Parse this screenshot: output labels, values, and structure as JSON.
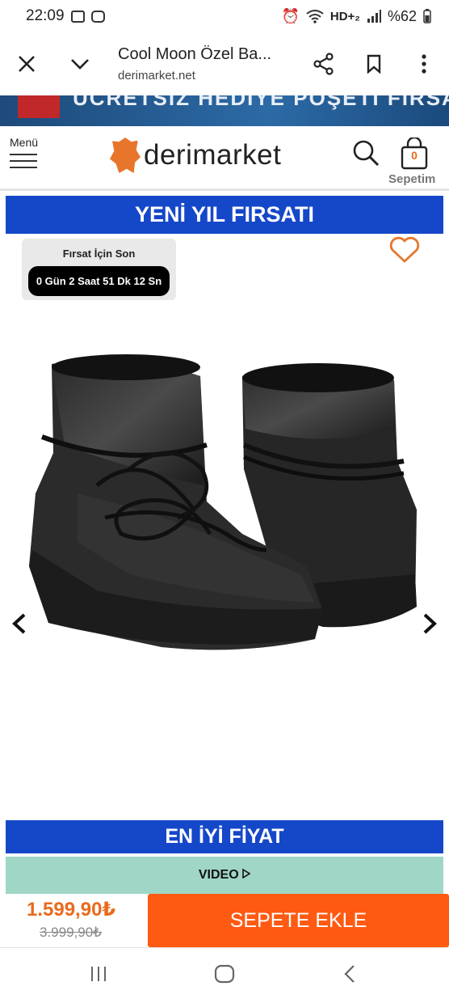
{
  "status_bar": {
    "time": "22:09",
    "network": "HD+₂",
    "battery": "%62"
  },
  "browser": {
    "page_title": "Cool Moon Özel Ba...",
    "domain": "derimarket.net"
  },
  "banner": {
    "text": "ÜCRETSİZ HEDİYE POŞETİ FIRSATI"
  },
  "site_header": {
    "menu_label": "Menü",
    "logo_text": "derimarket",
    "cart_count": "0",
    "cart_label": "Sepetim"
  },
  "promo_top": "YENİ YIL FIRSATI",
  "countdown": {
    "label": "Fırsat İçin Son",
    "value": "0 Gün 2 Saat 51 Dk 12 Sn"
  },
  "promo_bottom": "EN İYİ FİYAT",
  "video_label": "VIDEO",
  "pricing": {
    "price": "1.599,90₺",
    "old_price": "3.999,90₺",
    "add_to_cart": "SEPETE EKLE"
  },
  "colors": {
    "brand_orange": "#ff5a12",
    "price_orange": "#e86a1d",
    "promo_blue": "#1547c9",
    "video_teal": "#9fd6c6",
    "heart": "#e3792e"
  }
}
